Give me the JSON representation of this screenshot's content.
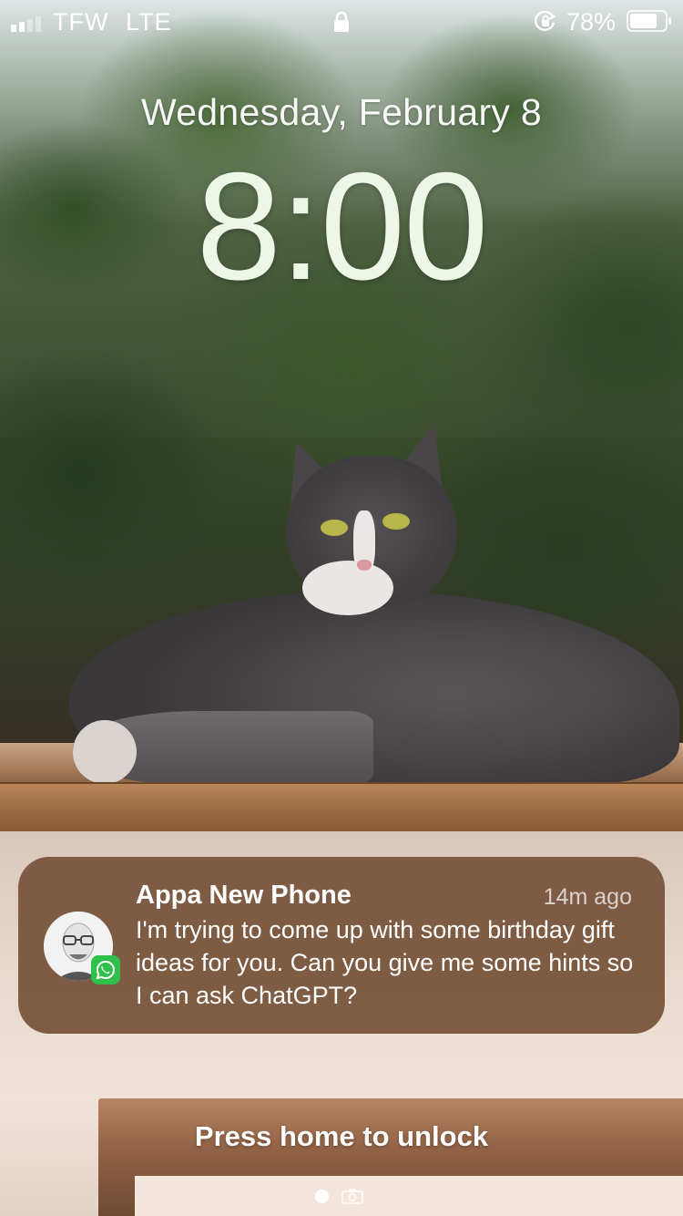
{
  "status_bar": {
    "carrier": "TFW",
    "network": "LTE",
    "battery_percent": "78%",
    "battery_level": 0.78,
    "signal_bars_active": 2,
    "signal_bars_total": 4,
    "icons": [
      "signal-icon",
      "lock-icon",
      "rotation-lock-icon",
      "battery-icon"
    ]
  },
  "lock_screen": {
    "date": "Wednesday, February 8",
    "time": "8:00"
  },
  "notification": {
    "app_icon": "whatsapp-icon",
    "title": "Appa New Phone",
    "time_ago": "14m ago",
    "body": "I'm trying to come up with some birthday gift ideas for you. Can you give me some hints so I can ask ChatGPT?"
  },
  "footer": {
    "unlock_hint": "Press home to unlock",
    "page_indicator_icons": [
      "page-dot",
      "camera-icon"
    ]
  },
  "colors": {
    "notification_bg": "#7a563e",
    "whatsapp_green": "#2fbf4a",
    "clock_text": "#eef6e8"
  }
}
